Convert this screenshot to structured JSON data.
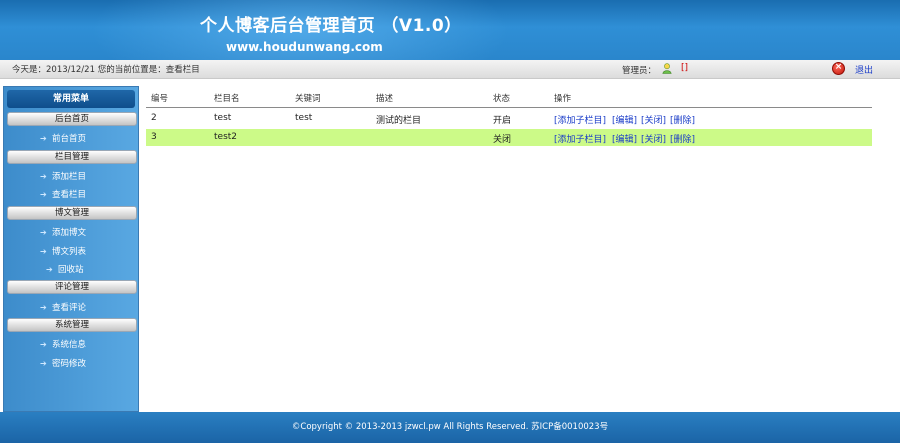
{
  "header": {
    "title": "个人博客后台管理首页 （V1.0）",
    "url": "www.houdunwang.com"
  },
  "infobar": {
    "today": "今天是：2013/12/21 您的当前位置是：查看栏目",
    "admin_label": "管理员：",
    "admin_name": "[]",
    "logout": "退出"
  },
  "sidebar": {
    "header": "常用菜单",
    "groups": [
      {
        "title": "后台首页",
        "items": [
          "前台首页"
        ]
      },
      {
        "title": "栏目管理",
        "items": [
          "添加栏目",
          "查看栏目"
        ]
      },
      {
        "title": "博文管理",
        "items": [
          "添加博文",
          "博文列表",
          "回收站"
        ]
      },
      {
        "title": "评论管理",
        "items": [
          "查看评论"
        ]
      },
      {
        "title": "系统管理",
        "items": [
          "系统信息",
          "密码修改"
        ]
      }
    ]
  },
  "table": {
    "headers": [
      "编号",
      "栏目名",
      "关键词",
      "描述",
      "状态",
      "操作"
    ],
    "rows": [
      {
        "id": "2",
        "name": "test",
        "keywords": "test",
        "desc": "测试的栏目",
        "status": "开启",
        "actions": [
          "[添加子栏目]",
          "[编辑]",
          "[关闭]",
          "[删除]"
        ],
        "highlight": false
      },
      {
        "id": "3",
        "name": "test2",
        "keywords": "",
        "desc": "",
        "status": "关闭",
        "actions": [
          "[添加子栏目]",
          "[编辑]",
          "[关闭]",
          "[删除]"
        ],
        "highlight": true
      }
    ]
  },
  "footer": {
    "copyright": "©Copyright © 2013-2013 jzwcl.pw All Rights Reserved. 苏ICP备0010023号"
  },
  "colors": {
    "header_blue": "#2f8fd6",
    "highlight_row": "#ccfa88",
    "link_blue": "#1a3cc8",
    "admin_red": "#cc0000"
  }
}
